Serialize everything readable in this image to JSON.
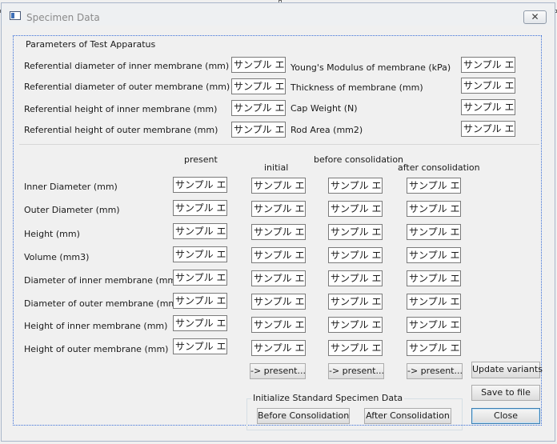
{
  "window": {
    "title": "Specimen Data",
    "close_glyph": "✕"
  },
  "apparatus": {
    "heading": "Parameters of Test Apparatus",
    "left": [
      {
        "label": "Referential diameter of inner membrane (mm)",
        "value": "サンプル エ:"
      },
      {
        "label": "Referential diameter of outer membrane (mm)",
        "value": "サンプル エ:"
      },
      {
        "label": "Referential height of inner membrane (mm)",
        "value": "サンプル エ:"
      },
      {
        "label": "Referential height of outer membrane (mm)",
        "value": "サンプル エ:"
      }
    ],
    "right": [
      {
        "label": "Young's Modulus of membrane (kPa)",
        "value": "サンプル エ:"
      },
      {
        "label": "Thickness of membrane (mm)",
        "value": "サンプル エ:"
      },
      {
        "label": "Cap Weight (N)",
        "value": "サンプル エ:"
      },
      {
        "label": "Rod Area (mm2)",
        "value": "サンプル エ:"
      }
    ]
  },
  "specimen": {
    "columns": {
      "present": "present",
      "initial": "initial",
      "before": "before consolidation",
      "after": "after consolidation"
    },
    "rows": [
      {
        "label": "Inner Diameter (mm)",
        "present": "サンプル エ:",
        "initial": "サンプル エ:",
        "before": "サンプル エ:",
        "after": "サンプル エ:"
      },
      {
        "label": "Outer Diameter (mm)",
        "present": "サンプル エ:",
        "initial": "サンプル エ:",
        "before": "サンプル エ:",
        "after": "サンプル エ:"
      },
      {
        "label": "Height (mm)",
        "present": "サンプル エ:",
        "initial": "サンプル エ:",
        "before": "サンプル エ:",
        "after": "サンプル エ:"
      },
      {
        "label": "Volume (mm3)",
        "present": "サンプル エ:",
        "initial": "サンプル エ:",
        "before": "サンプル エ:",
        "after": "サンプル エ:"
      },
      {
        "label": "Diameter of inner membrane (mm)",
        "present": "サンプル エ:",
        "initial": "サンプル エ:",
        "before": "サンプル エ:",
        "after": "サンプル エ:"
      },
      {
        "label": "Diameter of outer membrane (mm)",
        "present": "サンプル エ:",
        "initial": "サンプル エ:",
        "before": "サンプル エ:",
        "after": "サンプル エ:"
      },
      {
        "label": "Height of inner membrane (mm)",
        "present": "サンプル エ:",
        "initial": "サンプル エ:",
        "before": "サンプル エ:",
        "after": "サンプル エ:"
      },
      {
        "label": "Height of outer membrane (mm)",
        "present": "サンプル エ:",
        "initial": "サンプル エ:",
        "before": "サンプル エ:",
        "after": "サンプル エ:"
      }
    ],
    "copy_buttons": {
      "initial": "-> present...",
      "before": "-> present...",
      "after": "-> present..."
    }
  },
  "init_group": {
    "heading": "Initialize Standard Specimen Data",
    "before_button": "Before Consolidation",
    "after_button": "After Consolidation"
  },
  "actions": {
    "update": "Update variants",
    "save": "Save to file",
    "close": "Close"
  }
}
